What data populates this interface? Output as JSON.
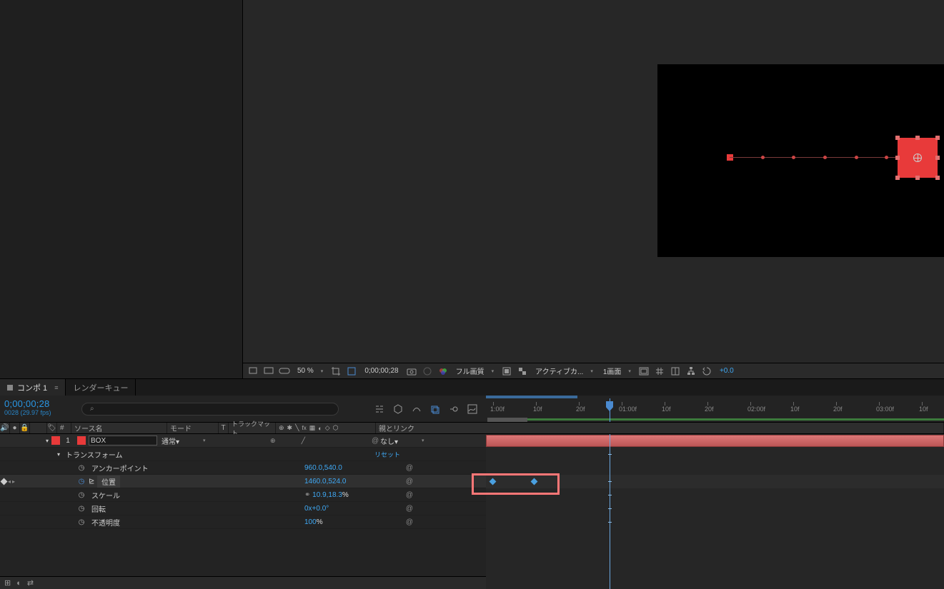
{
  "viewer": {
    "zoom": "50 %",
    "timecode": "0;00;00;28",
    "resolution": "フル画質",
    "camera": "アクティブカ...",
    "views": "1画面",
    "exposure": "+0.0"
  },
  "tabs": {
    "comp": "コンポ 1",
    "renderqueue": "レンダーキュー"
  },
  "timeline": {
    "timecode": "0;00;00;28",
    "frame_fps": "0028 (29.97 fps)",
    "search_placeholder": "",
    "cols": {
      "num": "#",
      "source": "ソース名",
      "mode": "モード",
      "trkmat_t": "T",
      "trkmat": "トラックマット",
      "parent": "親とリンク"
    },
    "ruler": [
      "1:00f",
      "10f",
      "20f",
      "01:00f",
      "10f",
      "20f",
      "02:00f",
      "10f",
      "20f",
      "03:00f",
      "10f"
    ],
    "layer": {
      "index": "1",
      "name": "BOX",
      "mode": "通常",
      "parent": "なし"
    },
    "transform": {
      "label": "トランスフォーム",
      "reset": "リセット",
      "anchor": {
        "label": "アンカーポイント",
        "value": "960.0,540.0"
      },
      "position": {
        "label": "位置",
        "value": "1460.0,524.0"
      },
      "scale": {
        "label": "スケール",
        "value": "10.9,18.3",
        "suffix": "%"
      },
      "rotation": {
        "label": "回転",
        "value": "0x+0.0°"
      },
      "opacity": {
        "label": "不透明度",
        "value": "100",
        "suffix": "%"
      }
    }
  }
}
